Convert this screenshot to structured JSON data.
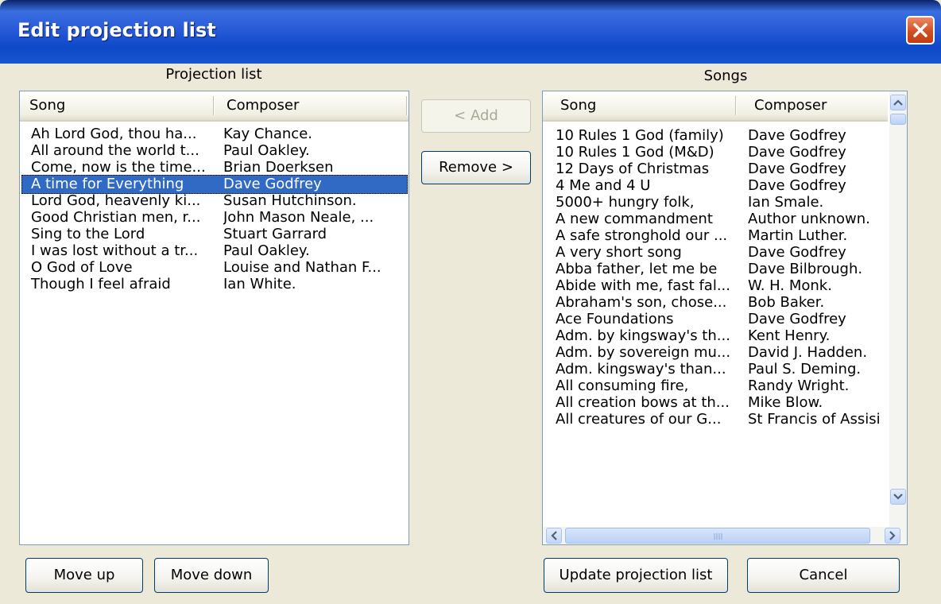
{
  "window": {
    "title": "Edit projection list",
    "close_icon": "close-icon"
  },
  "projection": {
    "caption": "Projection list",
    "headers": {
      "song": "Song",
      "composer": "Composer"
    },
    "rows": [
      {
        "song": "Ah Lord God, thou ha...",
        "composer": "Kay Chance."
      },
      {
        "song": "All around the world t...",
        "composer": "Paul Oakley."
      },
      {
        "song": "Come, now is the time...",
        "composer": "Brian Doerksen"
      },
      {
        "song": "A time for Everything",
        "composer": "Dave Godfrey",
        "selected": true
      },
      {
        "song": "Lord God, heavenly ki...",
        "composer": "Susan Hutchinson."
      },
      {
        "song": "Good Christian men, r...",
        "composer": "John Mason Neale, ..."
      },
      {
        "song": "Sing to the Lord",
        "composer": "Stuart Garrard"
      },
      {
        "song": "I was lost without a tr...",
        "composer": "Paul Oakley."
      },
      {
        "song": "O God of Love",
        "composer": "Louise and Nathan F..."
      },
      {
        "song": "Though I feel afraid",
        "composer": "Ian White."
      }
    ]
  },
  "songs": {
    "caption": "Songs",
    "headers": {
      "song": "Song",
      "composer": "Composer"
    },
    "rows": [
      {
        "song": "10 Rules 1 God (family)",
        "composer": "Dave Godfrey"
      },
      {
        "song": "10 Rules 1 God (M&D)",
        "composer": "Dave Godfrey"
      },
      {
        "song": "12 Days of Christmas",
        "composer": "Dave Godfrey"
      },
      {
        "song": "4 Me and 4 U",
        "composer": "Dave Godfrey"
      },
      {
        "song": "5000+ hungry folk,",
        "composer": "Ian Smale."
      },
      {
        "song": "A new commandment",
        "composer": "Author unknown."
      },
      {
        "song": "A safe stronghold our ...",
        "composer": "Martin Luther."
      },
      {
        "song": "A very short song",
        "composer": "Dave Godfrey"
      },
      {
        "song": "Abba father, let me be",
        "composer": "Dave Bilbrough."
      },
      {
        "song": "Abide with me, fast fal...",
        "composer": "W. H. Monk."
      },
      {
        "song": "Abraham's son, chose...",
        "composer": "Bob Baker."
      },
      {
        "song": "Ace Foundations",
        "composer": "Dave Godfrey"
      },
      {
        "song": "Adm. by kingsway's th...",
        "composer": "Kent Henry."
      },
      {
        "song": "Adm. by sovereign mu...",
        "composer": "David J. Hadden."
      },
      {
        "song": "Adm. kingsway's than...",
        "composer": "Paul S. Deming."
      },
      {
        "song": "All consuming fire,",
        "composer": "Randy Wright."
      },
      {
        "song": "All creation bows at th...",
        "composer": "Mike Blow."
      },
      {
        "song": "All creatures of our G...",
        "composer": "St Francis of Assisi"
      }
    ]
  },
  "buttons": {
    "add": "< Add",
    "remove": "Remove >",
    "move_up": "Move up",
    "move_down": "Move down",
    "update": "Update projection list",
    "cancel": "Cancel"
  }
}
